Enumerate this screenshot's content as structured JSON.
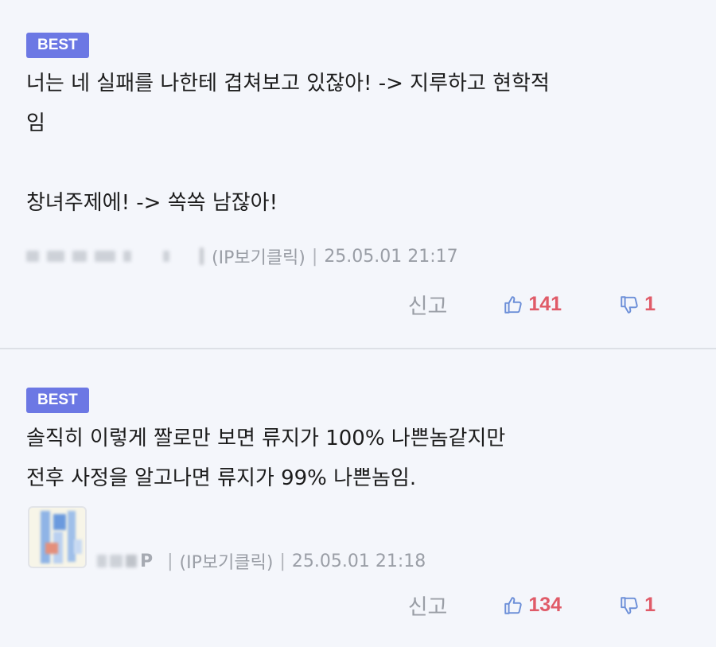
{
  "comments": [
    {
      "badge": "BEST",
      "text": "너는 네 실패를 나한테 겹쳐보고 있잖아! -> 지루하고 현학적\n임\n\n창녀주제에! -> 쏙쏙 남잖아!",
      "ip_label": "(IP보기클릭)",
      "timestamp": "25.05.01 21:17",
      "report_label": "신고",
      "likes": "141",
      "dislikes": "1"
    },
    {
      "badge": "BEST",
      "text": "솔직히 이렇게 짤로만 보면 류지가 100% 나쁜놈같지만\n전후 사정을 알고나면 류지가 99% 나쁜놈임.",
      "author_visible": "P",
      "ip_label": "(IP보기클릭)",
      "timestamp": "25.05.01 21:18",
      "report_label": "신고",
      "likes": "134",
      "dislikes": "1"
    }
  ],
  "colors": {
    "background": "#f4f6fb",
    "badge": "#6c78e4",
    "vote_count": "#e05b68",
    "thumb_icon": "#6c8fd8",
    "meta_text": "#9a9ea6"
  },
  "icons": [
    "thumbs-up-icon",
    "thumbs-down-icon"
  ]
}
